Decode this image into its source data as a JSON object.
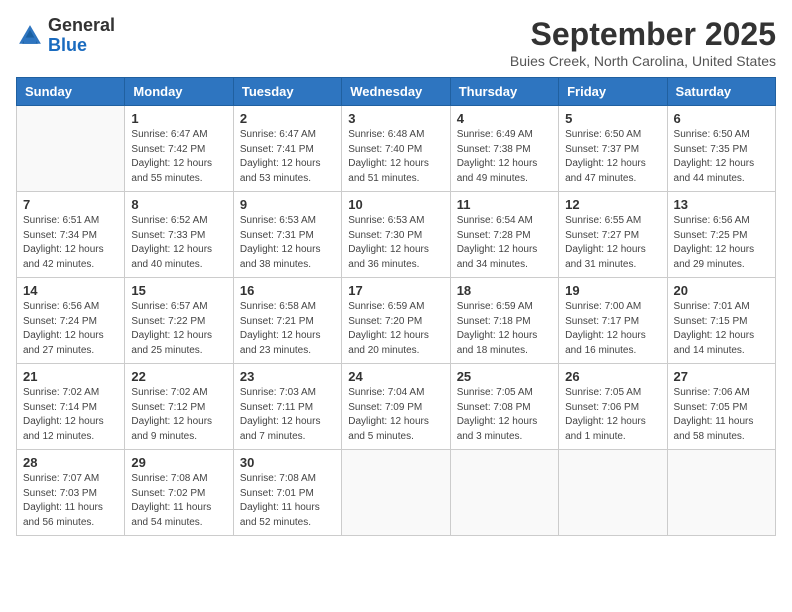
{
  "header": {
    "logo_general": "General",
    "logo_blue": "Blue",
    "month_title": "September 2025",
    "location": "Buies Creek, North Carolina, United States"
  },
  "days_of_week": [
    "Sunday",
    "Monday",
    "Tuesday",
    "Wednesday",
    "Thursday",
    "Friday",
    "Saturday"
  ],
  "weeks": [
    [
      {
        "day": "",
        "info": ""
      },
      {
        "day": "1",
        "info": "Sunrise: 6:47 AM\nSunset: 7:42 PM\nDaylight: 12 hours\nand 55 minutes."
      },
      {
        "day": "2",
        "info": "Sunrise: 6:47 AM\nSunset: 7:41 PM\nDaylight: 12 hours\nand 53 minutes."
      },
      {
        "day": "3",
        "info": "Sunrise: 6:48 AM\nSunset: 7:40 PM\nDaylight: 12 hours\nand 51 minutes."
      },
      {
        "day": "4",
        "info": "Sunrise: 6:49 AM\nSunset: 7:38 PM\nDaylight: 12 hours\nand 49 minutes."
      },
      {
        "day": "5",
        "info": "Sunrise: 6:50 AM\nSunset: 7:37 PM\nDaylight: 12 hours\nand 47 minutes."
      },
      {
        "day": "6",
        "info": "Sunrise: 6:50 AM\nSunset: 7:35 PM\nDaylight: 12 hours\nand 44 minutes."
      }
    ],
    [
      {
        "day": "7",
        "info": "Sunrise: 6:51 AM\nSunset: 7:34 PM\nDaylight: 12 hours\nand 42 minutes."
      },
      {
        "day": "8",
        "info": "Sunrise: 6:52 AM\nSunset: 7:33 PM\nDaylight: 12 hours\nand 40 minutes."
      },
      {
        "day": "9",
        "info": "Sunrise: 6:53 AM\nSunset: 7:31 PM\nDaylight: 12 hours\nand 38 minutes."
      },
      {
        "day": "10",
        "info": "Sunrise: 6:53 AM\nSunset: 7:30 PM\nDaylight: 12 hours\nand 36 minutes."
      },
      {
        "day": "11",
        "info": "Sunrise: 6:54 AM\nSunset: 7:28 PM\nDaylight: 12 hours\nand 34 minutes."
      },
      {
        "day": "12",
        "info": "Sunrise: 6:55 AM\nSunset: 7:27 PM\nDaylight: 12 hours\nand 31 minutes."
      },
      {
        "day": "13",
        "info": "Sunrise: 6:56 AM\nSunset: 7:25 PM\nDaylight: 12 hours\nand 29 minutes."
      }
    ],
    [
      {
        "day": "14",
        "info": "Sunrise: 6:56 AM\nSunset: 7:24 PM\nDaylight: 12 hours\nand 27 minutes."
      },
      {
        "day": "15",
        "info": "Sunrise: 6:57 AM\nSunset: 7:22 PM\nDaylight: 12 hours\nand 25 minutes."
      },
      {
        "day": "16",
        "info": "Sunrise: 6:58 AM\nSunset: 7:21 PM\nDaylight: 12 hours\nand 23 minutes."
      },
      {
        "day": "17",
        "info": "Sunrise: 6:59 AM\nSunset: 7:20 PM\nDaylight: 12 hours\nand 20 minutes."
      },
      {
        "day": "18",
        "info": "Sunrise: 6:59 AM\nSunset: 7:18 PM\nDaylight: 12 hours\nand 18 minutes."
      },
      {
        "day": "19",
        "info": "Sunrise: 7:00 AM\nSunset: 7:17 PM\nDaylight: 12 hours\nand 16 minutes."
      },
      {
        "day": "20",
        "info": "Sunrise: 7:01 AM\nSunset: 7:15 PM\nDaylight: 12 hours\nand 14 minutes."
      }
    ],
    [
      {
        "day": "21",
        "info": "Sunrise: 7:02 AM\nSunset: 7:14 PM\nDaylight: 12 hours\nand 12 minutes."
      },
      {
        "day": "22",
        "info": "Sunrise: 7:02 AM\nSunset: 7:12 PM\nDaylight: 12 hours\nand 9 minutes."
      },
      {
        "day": "23",
        "info": "Sunrise: 7:03 AM\nSunset: 7:11 PM\nDaylight: 12 hours\nand 7 minutes."
      },
      {
        "day": "24",
        "info": "Sunrise: 7:04 AM\nSunset: 7:09 PM\nDaylight: 12 hours\nand 5 minutes."
      },
      {
        "day": "25",
        "info": "Sunrise: 7:05 AM\nSunset: 7:08 PM\nDaylight: 12 hours\nand 3 minutes."
      },
      {
        "day": "26",
        "info": "Sunrise: 7:05 AM\nSunset: 7:06 PM\nDaylight: 12 hours\nand 1 minute."
      },
      {
        "day": "27",
        "info": "Sunrise: 7:06 AM\nSunset: 7:05 PM\nDaylight: 11 hours\nand 58 minutes."
      }
    ],
    [
      {
        "day": "28",
        "info": "Sunrise: 7:07 AM\nSunset: 7:03 PM\nDaylight: 11 hours\nand 56 minutes."
      },
      {
        "day": "29",
        "info": "Sunrise: 7:08 AM\nSunset: 7:02 PM\nDaylight: 11 hours\nand 54 minutes."
      },
      {
        "day": "30",
        "info": "Sunrise: 7:08 AM\nSunset: 7:01 PM\nDaylight: 11 hours\nand 52 minutes."
      },
      {
        "day": "",
        "info": ""
      },
      {
        "day": "",
        "info": ""
      },
      {
        "day": "",
        "info": ""
      },
      {
        "day": "",
        "info": ""
      }
    ]
  ]
}
